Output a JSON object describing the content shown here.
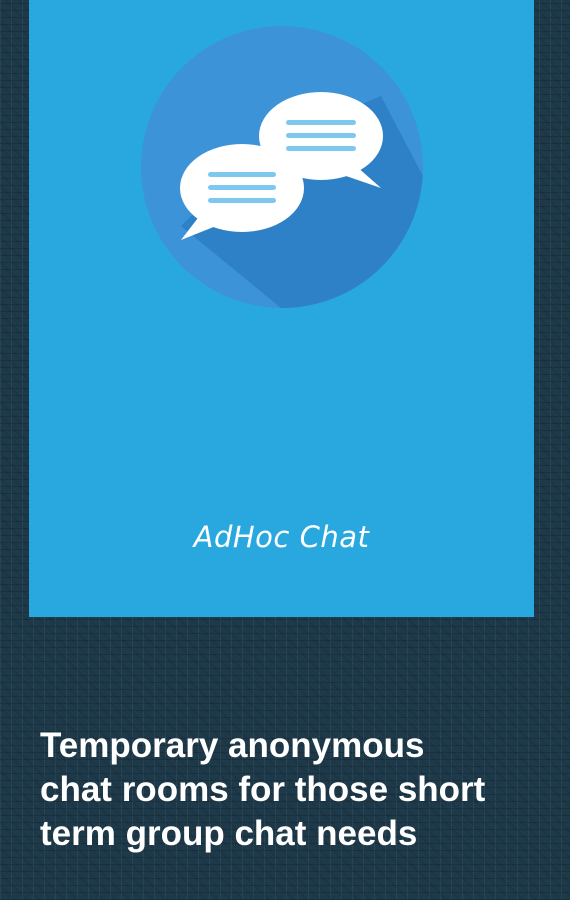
{
  "app": {
    "name": "AdHoc Chat",
    "icon": "chat-bubbles-icon"
  },
  "tagline": "Temporary anonymous\nchat rooms for those short\nterm group chat needs",
  "colors": {
    "background": "#1e3a4a",
    "screen": "#29a8e0",
    "circle": "#3b8fd6",
    "bubble": "#ffffff",
    "bubble_lines": "#7ec8f0"
  }
}
